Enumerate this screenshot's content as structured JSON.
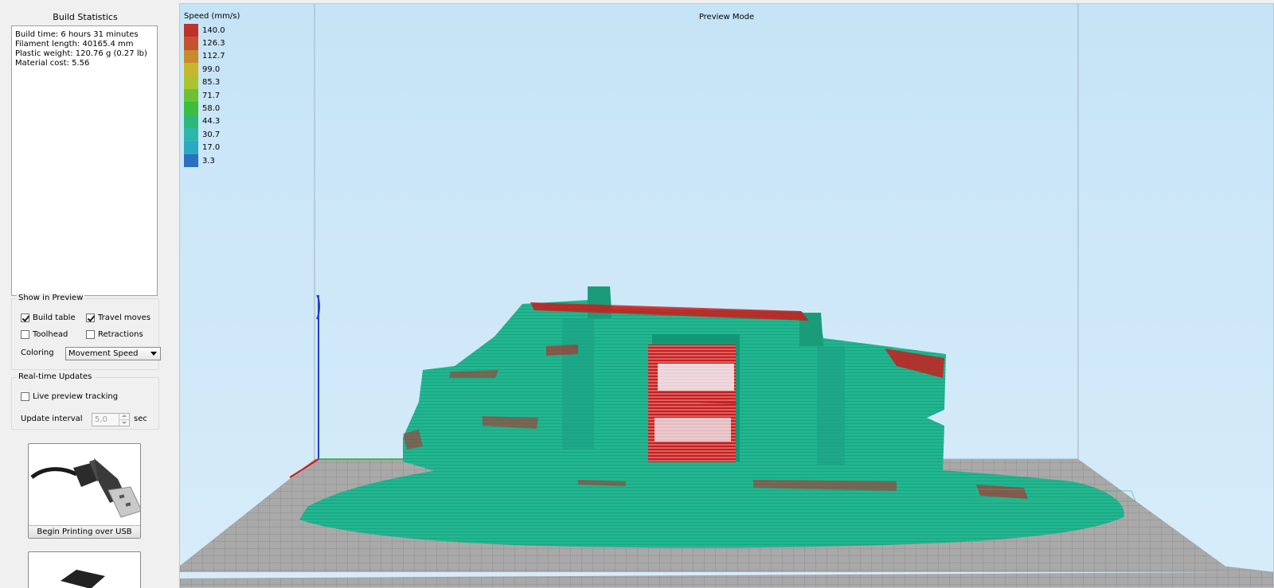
{
  "left_panel": {
    "build_statistics": {
      "title": "Build Statistics",
      "lines": [
        "Build time: 6 hours 31 minutes",
        "Filament length: 40165.4 mm",
        "Plastic weight: 120.76 g (0.27 lb)",
        "Material cost: 5.56"
      ]
    },
    "show_in_preview": {
      "title": "Show in Preview",
      "build_table": {
        "label": "Build table",
        "checked": true
      },
      "travel_moves": {
        "label": "Travel moves",
        "checked": true
      },
      "toolhead": {
        "label": "Toolhead",
        "checked": false
      },
      "retractions": {
        "label": "Retractions",
        "checked": false
      },
      "coloring_label": "Coloring",
      "coloring_value": "Movement Speed"
    },
    "realtime_updates": {
      "title": "Real-time Updates",
      "live_preview": {
        "label": "Live preview tracking",
        "checked": false
      },
      "update_interval_label": "Update interval",
      "update_interval_value": "5,0",
      "update_interval_unit": "sec"
    },
    "usb_button": {
      "label": "Begin Printing over USB",
      "icon": "usb-cable-icon"
    },
    "sd_button": {
      "icon": "sd-card-icon"
    }
  },
  "viewport": {
    "title": "Preview Mode",
    "legend": {
      "title": "Speed (mm/s)",
      "entries": [
        {
          "value": "140.0",
          "color": "#c0302c"
        },
        {
          "value": "126.3",
          "color": "#c6522c"
        },
        {
          "value": "112.7",
          "color": "#c88a2a"
        },
        {
          "value": "99.0",
          "color": "#c8b72c"
        },
        {
          "value": "85.3",
          "color": "#a8c42e"
        },
        {
          "value": "71.7",
          "color": "#6ac232"
        },
        {
          "value": "58.0",
          "color": "#3cbd3c"
        },
        {
          "value": "44.3",
          "color": "#2cb87a"
        },
        {
          "value": "30.7",
          "color": "#2cb8a8"
        },
        {
          "value": "17.0",
          "color": "#2aa8c4"
        },
        {
          "value": "3.3",
          "color": "#2a6fc0"
        }
      ]
    },
    "colors": {
      "model": "#20b58f",
      "model_dark": "#1a9c7a",
      "fast": "#c42020",
      "bed": "#a8a8a8",
      "bed_grid": "#8c8c8c"
    }
  }
}
